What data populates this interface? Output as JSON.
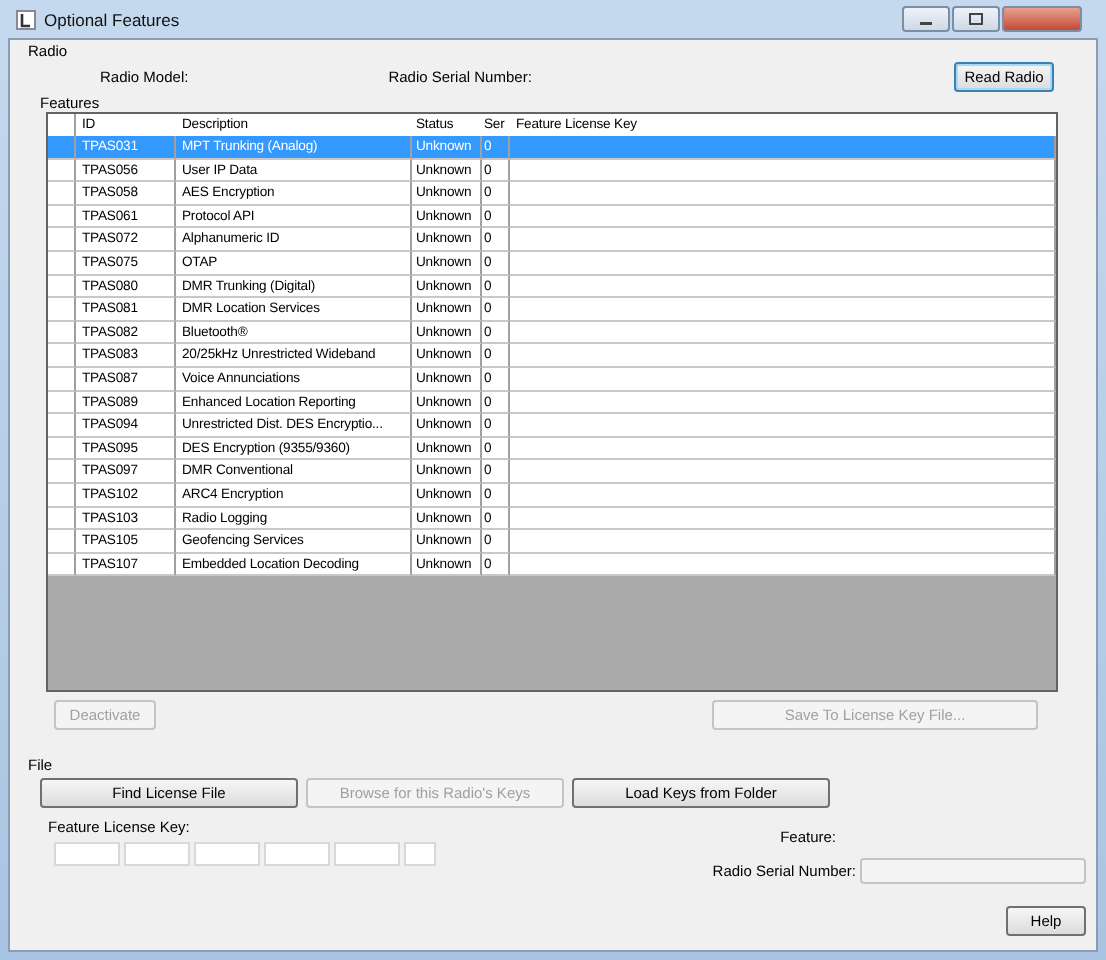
{
  "window": {
    "title": "Optional Features"
  },
  "radio": {
    "label": "Radio",
    "model_label": "Radio Model:",
    "serial_label": "Radio Serial Number:",
    "read_button": {
      "label": "Read Radio",
      "default": true
    }
  },
  "features": {
    "label": "Features",
    "columns": [
      "ID",
      "Description",
      "Status",
      "Ser",
      "Feature License Key"
    ],
    "rows": [
      {
        "id": "TPAS031",
        "description": "MPT Trunking (Analog)",
        "status": "Unknown",
        "ser": "0",
        "selected": true
      },
      {
        "id": "TPAS056",
        "description": "User IP Data",
        "status": "Unknown",
        "ser": "0",
        "selected": false
      },
      {
        "id": "TPAS058",
        "description": "AES Encryption",
        "status": "Unknown",
        "ser": "0",
        "selected": false
      },
      {
        "id": "TPAS061",
        "description": "Protocol API",
        "status": "Unknown",
        "ser": "0",
        "selected": false
      },
      {
        "id": "TPAS072",
        "description": "Alphanumeric ID",
        "status": "Unknown",
        "ser": "0",
        "selected": false
      },
      {
        "id": "TPAS075",
        "description": "OTAP",
        "status": "Unknown",
        "ser": "0",
        "selected": false
      },
      {
        "id": "TPAS080",
        "description": "DMR Trunking (Digital)",
        "status": "Unknown",
        "ser": "0",
        "selected": false
      },
      {
        "id": "TPAS081",
        "description": "DMR Location Services",
        "status": "Unknown",
        "ser": "0",
        "selected": false
      },
      {
        "id": "TPAS082",
        "description": "Bluetooth®",
        "status": "Unknown",
        "ser": "0",
        "selected": false
      },
      {
        "id": "TPAS083",
        "description": "20/25kHz Unrestricted Wideband",
        "status": "Unknown",
        "ser": "0",
        "selected": false
      },
      {
        "id": "TPAS087",
        "description": "Voice Annunciations",
        "status": "Unknown",
        "ser": "0",
        "selected": false
      },
      {
        "id": "TPAS089",
        "description": "Enhanced Location Reporting",
        "status": "Unknown",
        "ser": "0",
        "selected": false
      },
      {
        "id": "TPAS094",
        "description": "Unrestricted Dist. DES Encryptio...",
        "status": "Unknown",
        "ser": "0",
        "selected": false
      },
      {
        "id": "TPAS095",
        "description": "DES Encryption (9355/9360)",
        "status": "Unknown",
        "ser": "0",
        "selected": false
      },
      {
        "id": "TPAS097",
        "description": "DMR Conventional",
        "status": "Unknown",
        "ser": "0",
        "selected": false
      },
      {
        "id": "TPAS102",
        "description": "ARC4 Encryption",
        "status": "Unknown",
        "ser": "0",
        "selected": false
      },
      {
        "id": "TPAS103",
        "description": "Radio Logging",
        "status": "Unknown",
        "ser": "0",
        "selected": false
      },
      {
        "id": "TPAS105",
        "description": "Geofencing Services",
        "status": "Unknown",
        "ser": "0",
        "selected": false
      },
      {
        "id": "TPAS107",
        "description": "Embedded Location Decoding",
        "status": "Unknown",
        "ser": "0",
        "selected": false
      }
    ],
    "deactivate_button": {
      "label": "Deactivate",
      "disabled": true
    },
    "save_button": {
      "label": "Save To License Key File...",
      "disabled": true
    }
  },
  "file": {
    "label": "File",
    "buttons": [
      {
        "label": "Find License File",
        "disabled": false
      },
      {
        "label": "Browse for this Radio's Keys",
        "disabled": true
      },
      {
        "label": "Load Keys from Folder",
        "disabled": false
      }
    ],
    "key_label": "Feature License Key:",
    "feature_label": "Feature:",
    "serial_label": "Radio Serial Number:"
  },
  "help_button": "Help"
}
